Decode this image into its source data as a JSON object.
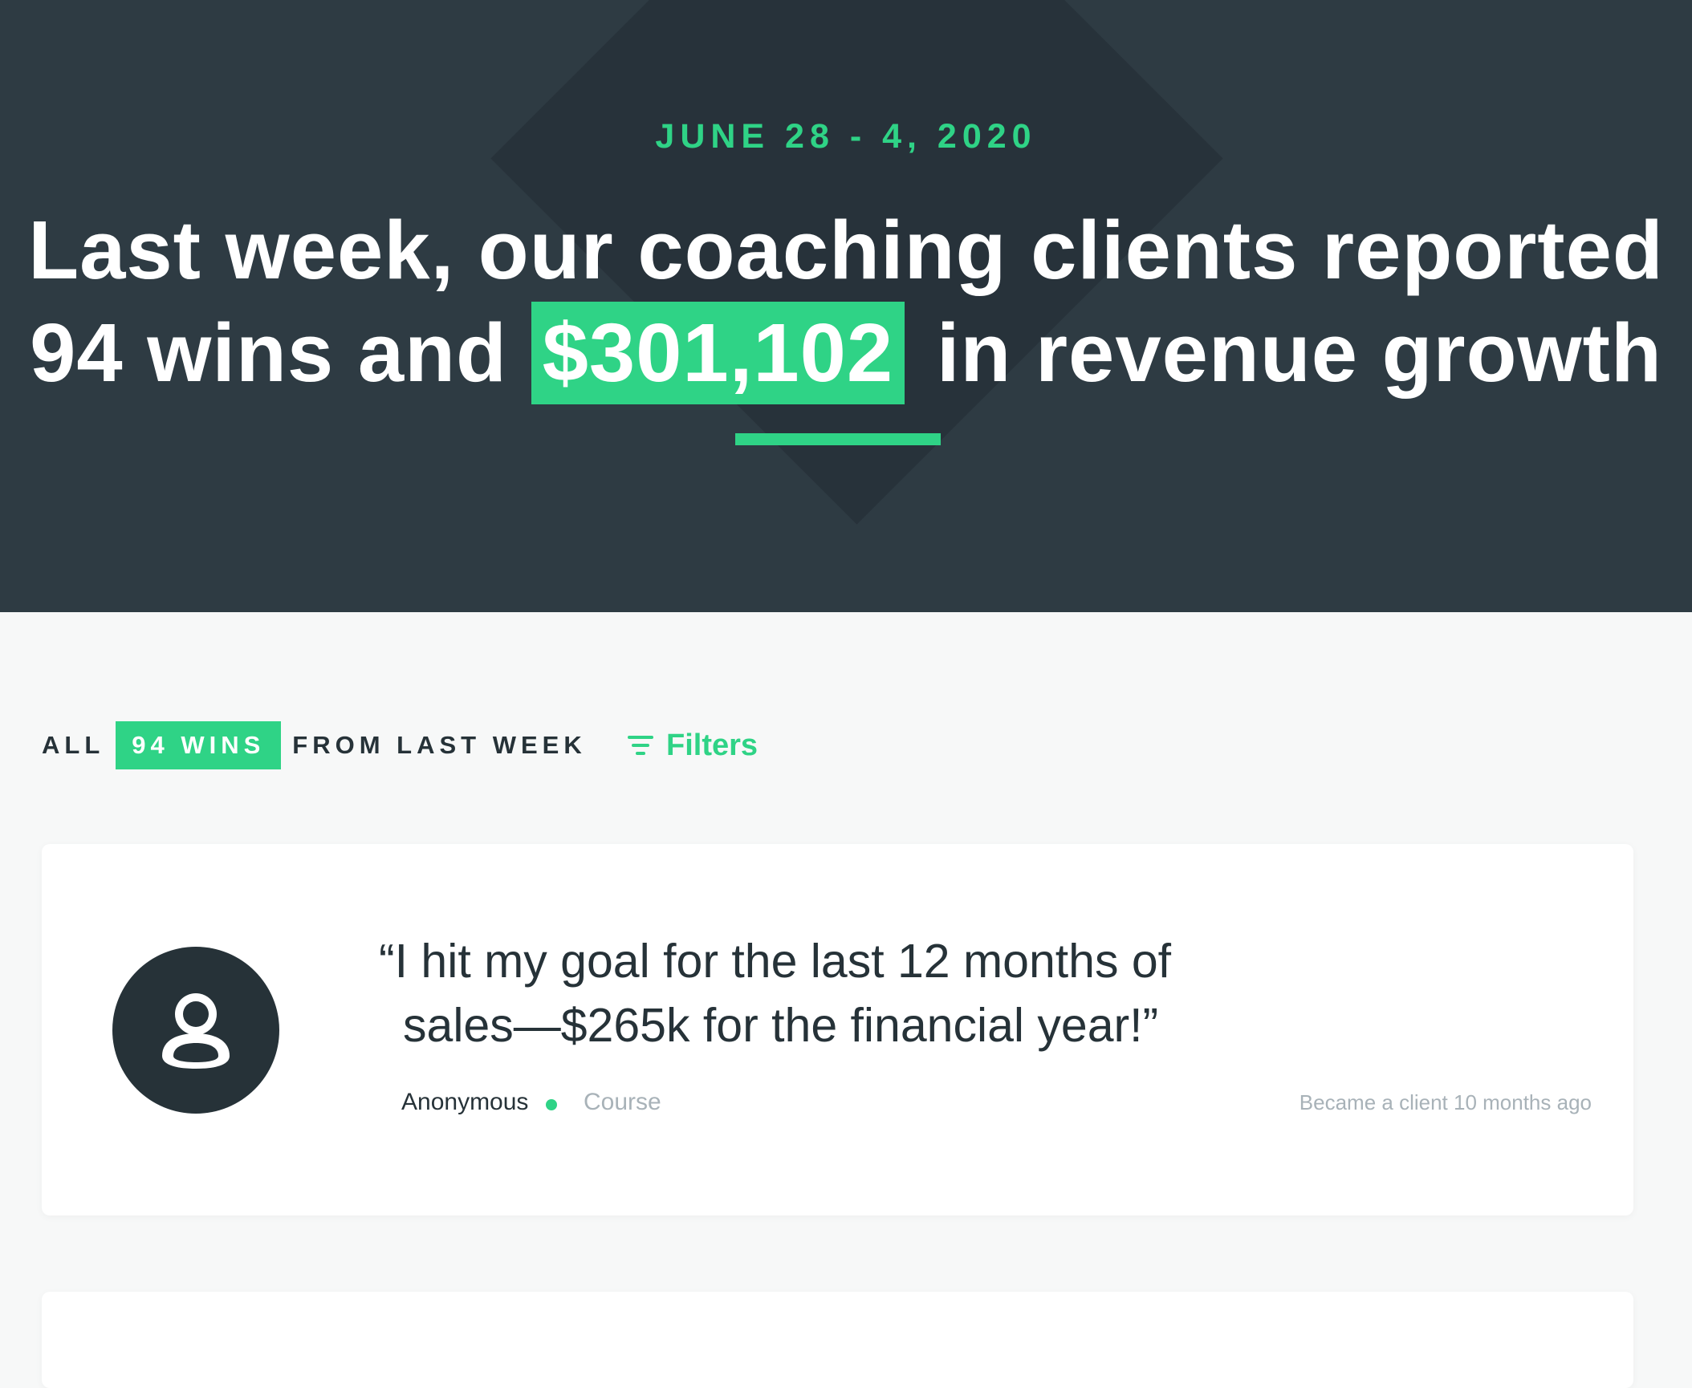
{
  "hero": {
    "date_range": "JUNE 28 - 4, 2020",
    "title_line1": "Last week, our coaching clients reported",
    "title_line2_prefix": "94 wins and",
    "title_amount": "$301,102",
    "title_line2_suffix": "in revenue growth"
  },
  "wins_bar": {
    "prefix": "ALL",
    "badge": "94 WINS",
    "suffix": "FROM LAST WEEK",
    "filters_label": "Filters",
    "filters_icon": "filter-lines-icon"
  },
  "wins": [
    {
      "avatar_icon": "user-silhouette-icon",
      "quote_line1": "“I hit my goal for the last 12 months of",
      "quote_line2": "sales—$265k for the financial year!”",
      "author": "Anonymous",
      "category": "Course",
      "client_since": "Became a client 10 months ago"
    }
  ],
  "colors": {
    "accent": "#2fd386",
    "hero_bg": "#2e3b43",
    "hero_diamond": "#27323a",
    "text_dark": "#263238",
    "text_muted": "#a8b2b8",
    "page_bg": "#f7f8f8"
  }
}
